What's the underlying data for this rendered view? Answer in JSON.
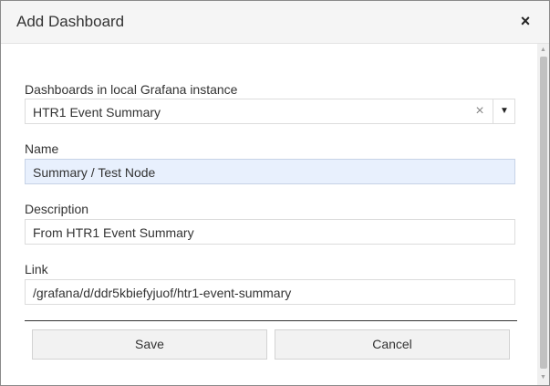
{
  "dialog": {
    "title": "Add Dashboard",
    "close_label": "×"
  },
  "form": {
    "dashboards_label": "Dashboards in local Grafana instance",
    "dashboards_selected": "HTR1 Event Summary",
    "clear_label": "×",
    "caret_label": "▼",
    "name_label": "Name",
    "name_value": "Summary / Test Node",
    "description_label": "Description",
    "description_value": "From HTR1 Event Summary",
    "link_label": "Link",
    "link_value": "/grafana/d/ddr5kbiefyjuof/htr1-event-summary"
  },
  "buttons": {
    "save_label": "Save",
    "cancel_label": "Cancel"
  },
  "scrollbar": {
    "up_arrow": "▲",
    "down_arrow": "▼"
  }
}
